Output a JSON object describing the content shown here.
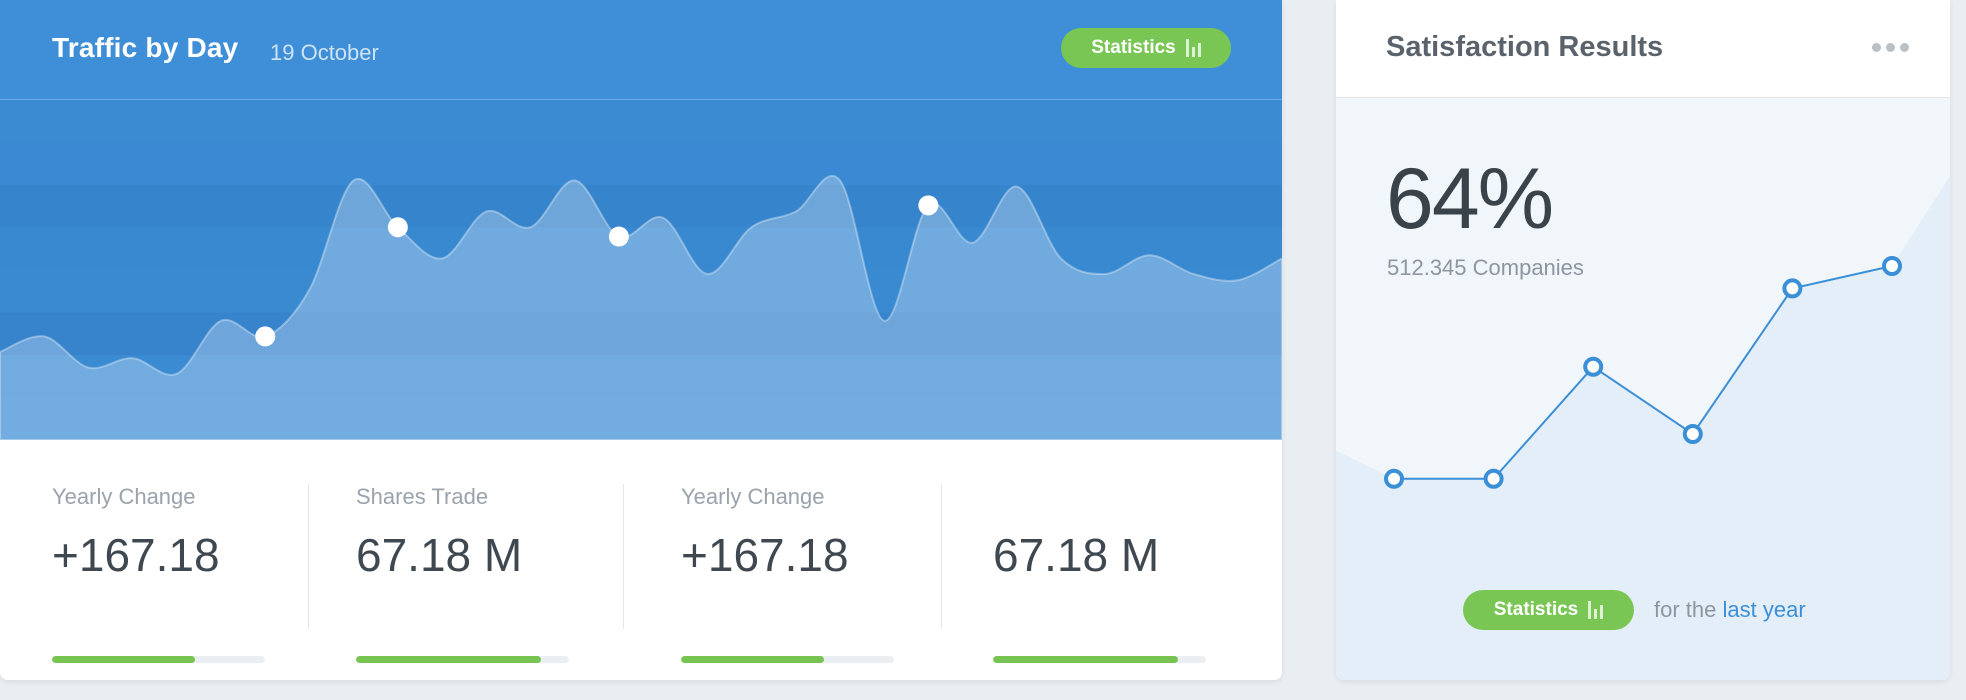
{
  "traffic": {
    "title": "Traffic by Day",
    "date": "19 October",
    "statistics_label": "Statistics",
    "stats_icon": "bar-chart-icon",
    "colors": {
      "header": "#3e8fd7",
      "pill": "#7ac654",
      "progress": "#78c452"
    },
    "stats": [
      {
        "label": "Yearly Change",
        "value": "+167.18",
        "progress": 0.67
      },
      {
        "label": "Shares Trade",
        "value": "67.18 M",
        "progress": 0.87
      },
      {
        "label": "Yearly Change",
        "value": "+167.18",
        "progress": 0.67
      },
      {
        "label": "",
        "value": "67.18 M",
        "progress": 0.87
      }
    ]
  },
  "satisfaction": {
    "title": "Satisfaction Results",
    "more_icon": "more-dots-icon",
    "percent": "64%",
    "companies": "512.345 Companies",
    "statistics_label": "Statistics",
    "footnote_prefix": "for the",
    "footnote_link": "last year",
    "colors": {
      "line": "#3b8fd6",
      "area": "#e6eff8"
    }
  },
  "chart_data": [
    {
      "type": "area",
      "x": [
        0,
        1,
        2,
        3,
        4,
        5,
        6,
        7,
        8,
        9,
        10,
        11,
        12,
        13,
        14,
        15,
        16,
        17,
        18,
        19,
        20,
        21,
        22,
        23,
        24,
        25,
        26,
        27,
        28,
        29
      ],
      "values": [
        25,
        30,
        20,
        23,
        18,
        35,
        30,
        45,
        80,
        65,
        55,
        70,
        65,
        80,
        62,
        68,
        50,
        65,
        70,
        80,
        35,
        72,
        60,
        78,
        55,
        50,
        56,
        50,
        48,
        55
      ],
      "highlight_points": [
        6,
        9,
        14,
        21
      ],
      "ylim": [
        0,
        100
      ],
      "grid": "horizontal bands"
    },
    {
      "type": "line",
      "x": [
        1,
        2,
        3,
        4,
        5,
        6
      ],
      "values": [
        32,
        32,
        52,
        40,
        66,
        70
      ],
      "ylim": [
        0,
        100
      ],
      "grid": false
    }
  ]
}
